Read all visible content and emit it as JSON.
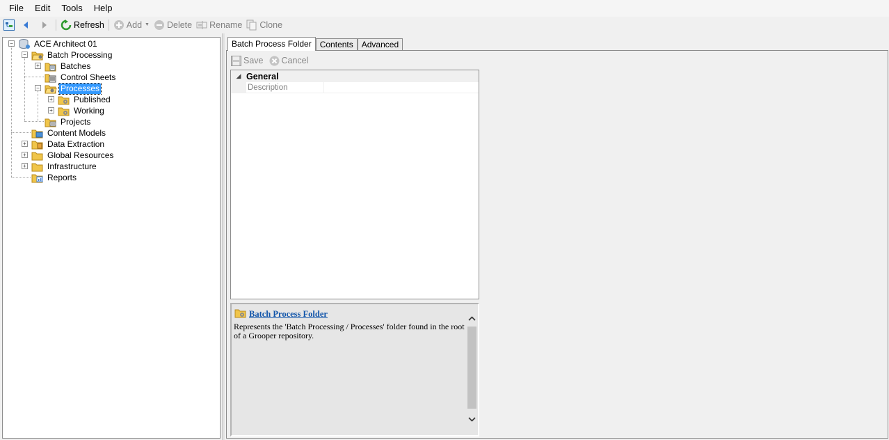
{
  "menu": [
    "File",
    "Edit",
    "Tools",
    "Help"
  ],
  "toolbar": {
    "refresh": "Refresh",
    "add": "Add",
    "delete": "Delete",
    "rename": "Rename",
    "clone": "Clone"
  },
  "tree": {
    "root": "ACE Architect 01",
    "batch_processing": "Batch Processing",
    "batches": "Batches",
    "control_sheets": "Control Sheets",
    "processes": "Processes",
    "published": "Published",
    "working": "Working",
    "projects": "Projects",
    "content_models": "Content Models",
    "data_extraction": "Data Extraction",
    "global_resources": "Global Resources",
    "infrastructure": "Infrastructure",
    "reports": "Reports"
  },
  "tabs": [
    "Batch Process Folder",
    "Contents",
    "Advanced"
  ],
  "actions": {
    "save": "Save",
    "cancel": "Cancel"
  },
  "property_grid": {
    "category": "General",
    "rows": [
      {
        "name": "Description",
        "value": ""
      }
    ]
  },
  "help": {
    "title": "Batch Process Folder",
    "text": "Represents the 'Batch Processing / Processes' folder found in the root of a Grooper repository."
  }
}
